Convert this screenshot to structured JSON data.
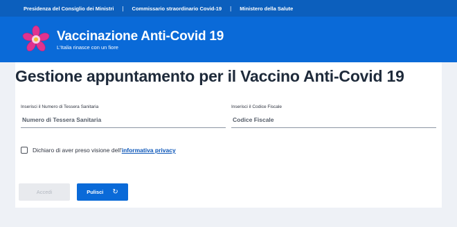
{
  "topbar": {
    "links": [
      "Presidenza del Consiglio dei Ministri",
      "Commissario straordinario Covid-19",
      "Ministero della Salute"
    ],
    "separator": "|"
  },
  "header": {
    "title": "Vaccinazione Anti-Covid 19",
    "subtitle": "L'Italia rinasce con un fiore",
    "logo_icon": "primula-flower-icon",
    "colors": {
      "topbar": "#0c5fbd",
      "header": "#0a6ad8",
      "flower": "#e0338f"
    }
  },
  "main": {
    "title": "Gestione appuntamento per il Vaccino Anti-Covid 19",
    "tessera": {
      "label": "Inserisci il Numero di Tessera Sanitaria",
      "placeholder": "Numero di Tessera Sanitaria",
      "value": ""
    },
    "codice": {
      "label": "Inserisci il Codice Fiscale",
      "placeholder": "Codice Fiscale",
      "value": ""
    },
    "privacy": {
      "checked": false,
      "text": "Dichiaro di aver preso visione dell'",
      "link": "informativa privacy"
    },
    "buttons": {
      "accedi": "Accedi",
      "pulisci": "Pulisci",
      "pulisci_icon": "refresh-icon"
    }
  }
}
